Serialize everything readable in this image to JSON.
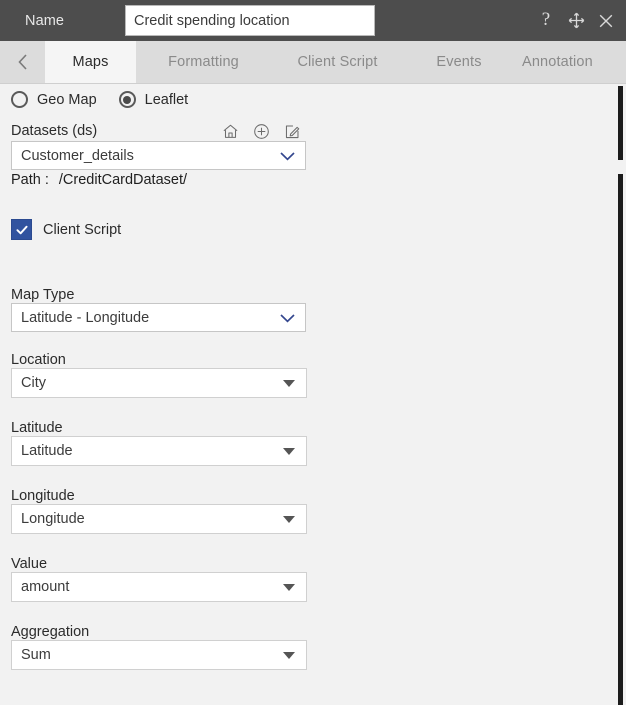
{
  "titlebar": {
    "name_label": "Name",
    "name_value": "Credit spending location",
    "name_placeholder": "Name",
    "help_icon": "question-mark-icon",
    "move_icon": "move-cross-icon",
    "close_icon": "close-x-icon"
  },
  "tabs": {
    "prev_arrow": "chevron-left-icon",
    "next_arrow": "chevron-right-icon",
    "items": [
      {
        "label": "Maps",
        "active": true
      },
      {
        "label": "Formatting",
        "active": false
      },
      {
        "label": "Client Script",
        "active": false
      },
      {
        "label": "Events",
        "active": false
      },
      {
        "label": "Annotation",
        "active": false
      }
    ]
  },
  "panel": {
    "map_engine": {
      "options": [
        {
          "label": "Geo Map",
          "selected": false
        },
        {
          "label": "Leaflet",
          "selected": true
        }
      ]
    },
    "datasets": {
      "label": "Datasets (ds)",
      "value": "Customer_details",
      "icons": [
        "home-icon",
        "plus-circle-icon",
        "edit-pencil-icon"
      ]
    },
    "path": {
      "key": "Path :",
      "value": "/CreditCardDataset/"
    },
    "client_script": {
      "label": "Client Script",
      "checked": true
    },
    "fields": [
      {
        "label": "Map Type",
        "value": "Latitude - Longitude"
      },
      {
        "label": "Location",
        "value": "City"
      },
      {
        "label": "Latitude",
        "value": "Latitude"
      },
      {
        "label": "Longitude",
        "value": "Longitude"
      },
      {
        "label": "Value",
        "value": "amount"
      },
      {
        "label": "Aggregation",
        "value": "Sum"
      }
    ]
  },
  "colors": {
    "titlebar_bg": "#4d4d4d",
    "tabbar_bg": "#dcdcdc",
    "active_tab_bg": "#f5f5f5",
    "content_bg": "#f2f2f2",
    "checkbox_blue": "#31539f",
    "chevron_blue": "#33468e"
  }
}
